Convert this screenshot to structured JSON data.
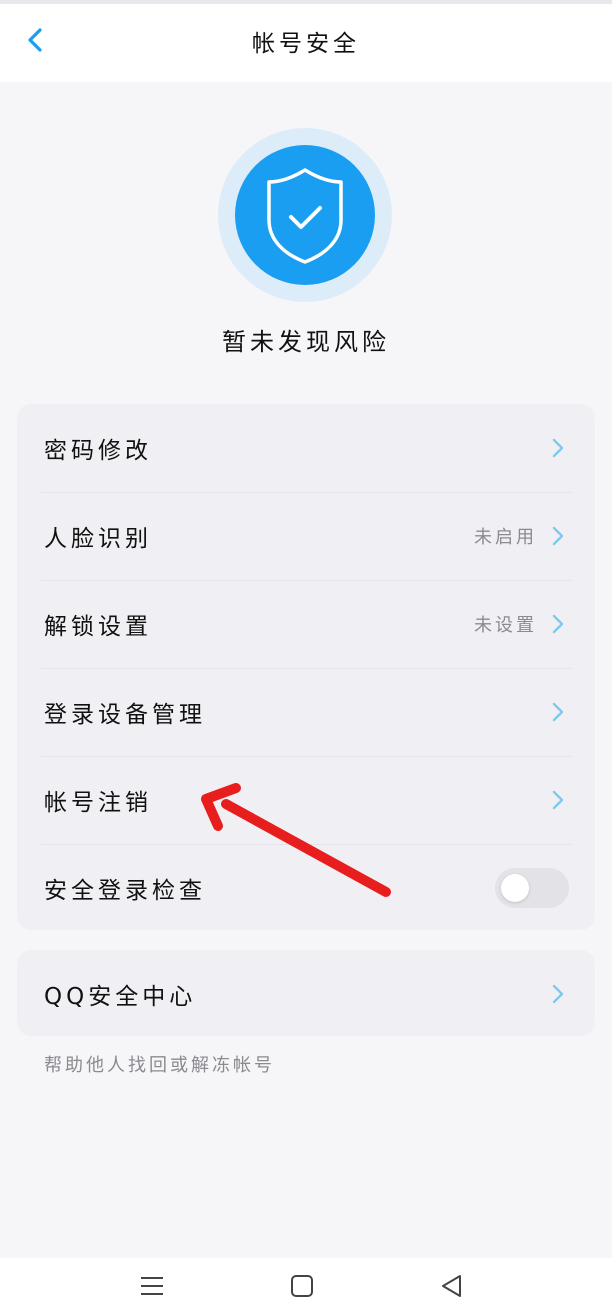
{
  "header": {
    "title": "帐号安全",
    "back_icon": "chevron-left-icon"
  },
  "status": {
    "text": "暂未发现风险",
    "icon": "shield-check-icon"
  },
  "settings": {
    "items": [
      {
        "label": "密码修改",
        "value": ""
      },
      {
        "label": "人脸识别",
        "value": "未启用"
      },
      {
        "label": "解锁设置",
        "value": "未设置"
      },
      {
        "label": "登录设备管理",
        "value": ""
      },
      {
        "label": "帐号注销",
        "value": ""
      },
      {
        "label": "安全登录检查",
        "value": ""
      }
    ]
  },
  "safe_login_check": {
    "enabled": false
  },
  "qq_center": {
    "label": "QQ安全中心"
  },
  "help": {
    "text": "帮助他人找回或解冻帐号"
  },
  "system_nav": {
    "menu_icon": "menu-icon",
    "home_icon": "home-square-icon",
    "back_icon": "back-triangle-icon"
  },
  "colors": {
    "accent": "#1a9ef2",
    "shield_ring": "#dcedf9",
    "chevron": "#7fc9f0",
    "annotation": "#e81d1d",
    "background": "#f6f6f9",
    "card": "#f0f0f4"
  }
}
